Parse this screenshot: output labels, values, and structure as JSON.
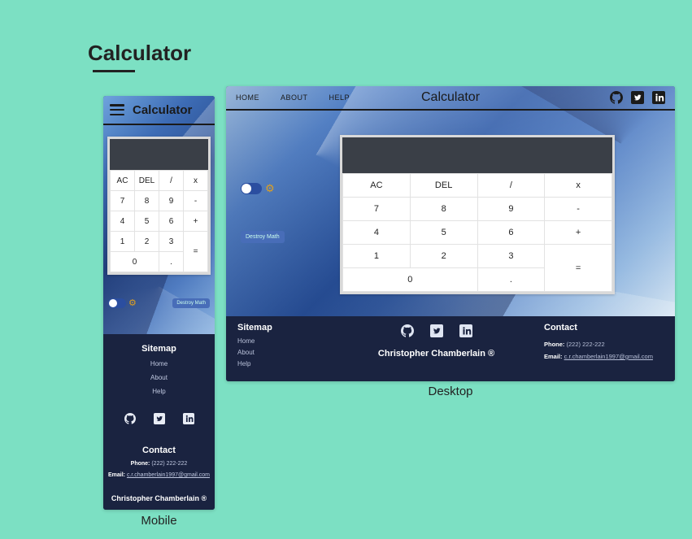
{
  "page": {
    "title": "Calculator",
    "mobile_caption": "Mobile",
    "desktop_caption": "Desktop"
  },
  "app": {
    "title": "Calculator",
    "nav": {
      "home": "HOME",
      "about": "ABOUT",
      "help": "HELP"
    },
    "destroy_label": "Destroy Math"
  },
  "calc": {
    "row0": {
      "c0": "AC",
      "c1": "DEL",
      "c2": "/",
      "c3": "x"
    },
    "row1": {
      "c0": "7",
      "c1": "8",
      "c2": "9",
      "c3": "-"
    },
    "row2": {
      "c0": "4",
      "c1": "5",
      "c2": "6",
      "c3": "+"
    },
    "row3": {
      "c0": "1",
      "c1": "2",
      "c2": "3",
      "c3": "="
    },
    "row4": {
      "c0": "0",
      "c1": "."
    }
  },
  "footer": {
    "sitemap_title": "Sitemap",
    "links": {
      "home": "Home",
      "about": "About",
      "help": "Help"
    },
    "contact_title": "Contact",
    "phone_label": "Phone:",
    "phone_value": "(222) 222-222",
    "email_label": "Email:",
    "email_value": "c.r.chamberlain1997@gmail.com",
    "copyright": "Christopher Chamberlain ®"
  }
}
